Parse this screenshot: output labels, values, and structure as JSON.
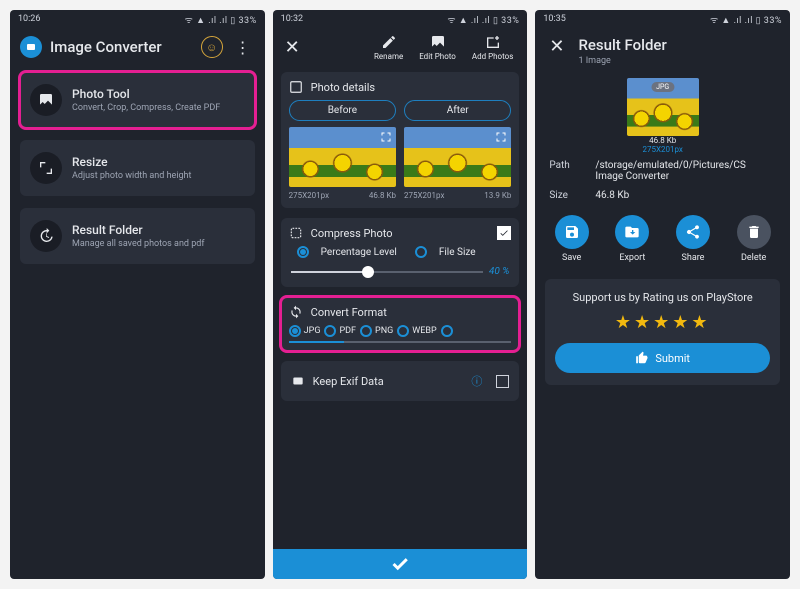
{
  "statusbar": {
    "times": [
      "10:26",
      "10:32",
      "10:35"
    ],
    "right": "ᯤ ▲ .ıl .ıl ▯ 33%"
  },
  "screen1": {
    "app_title": "Image Converter",
    "cards": [
      {
        "title": "Photo Tool",
        "sub": "Convert, Crop, Compress, Create PDF"
      },
      {
        "title": "Resize",
        "sub": "Adjust photo width and height"
      },
      {
        "title": "Result Folder",
        "sub": "Manage all saved photos and pdf"
      }
    ]
  },
  "screen2": {
    "actions": {
      "rename": "Rename",
      "edit": "Edit Photo",
      "add": "Add Photos"
    },
    "photo_details": {
      "label": "Photo details",
      "before": "Before",
      "after": "After",
      "before_dim": "275X201px",
      "before_size": "46.8 Kb",
      "after_dim": "275X201px",
      "after_size": "13.9 Kb"
    },
    "compress": {
      "label": "Compress Photo",
      "mode_percentage": "Percentage Level",
      "mode_filesize": "File Size",
      "percent": "40 %"
    },
    "convert": {
      "label": "Convert Format",
      "formats": [
        "JPG",
        "PDF",
        "PNG",
        "WEBP"
      ]
    },
    "exif": {
      "label": "Keep Exif Data"
    }
  },
  "screen3": {
    "title": "Result Folder",
    "subtitle": "1 Image",
    "thumb": {
      "tag": "JPG",
      "size": "46.8 Kb",
      "dim": "275X201px"
    },
    "path_label": "Path",
    "path_value": "/storage/emulated/0/Pictures/CS Image Converter",
    "size_label": "Size",
    "size_value": "46.8 Kb",
    "actions": {
      "save": "Save",
      "export": "Export",
      "share": "Share",
      "delete": "Delete"
    },
    "rate_msg": "Support us by Rating us on PlayStore",
    "submit": "Submit"
  }
}
